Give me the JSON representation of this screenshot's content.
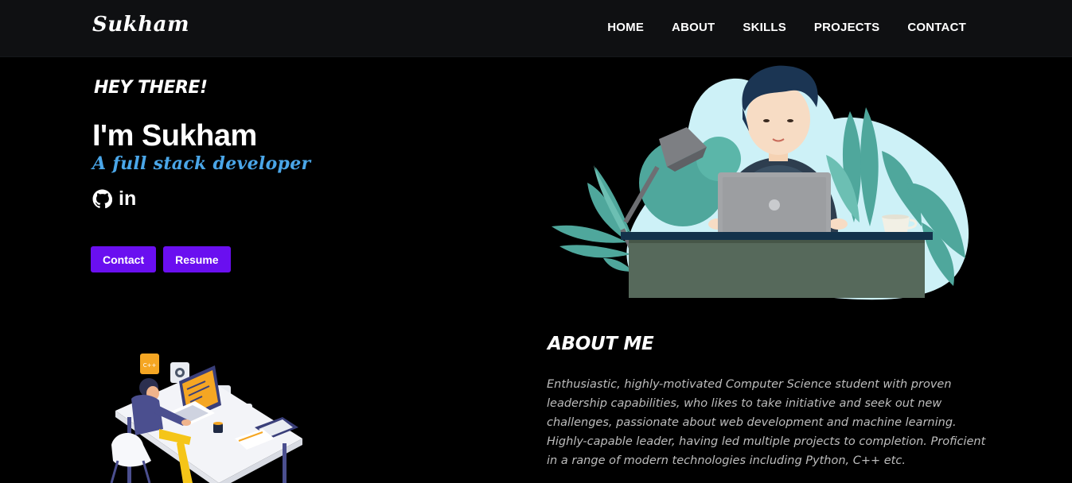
{
  "nav": {
    "logo": "Sukham",
    "links": [
      "HOME",
      "ABOUT",
      "SKILLS",
      "PROJECTS",
      "CONTACT"
    ]
  },
  "hero": {
    "greeting": "HEY THERE!",
    "name": "I'm Sukham",
    "role": "A full stack developer",
    "social": {
      "github_icon": "github-icon",
      "linkedin_text": "in"
    },
    "buttons": {
      "contact": "Contact",
      "resume": "Resume"
    }
  },
  "about": {
    "title": "ABOUT ME",
    "text": "Enthusiastic, highly-motivated Computer Science student with proven leadership capabilities, who likes to take initiative and seek out new challenges, passionate about web development and machine learning. Highly-capable leader, having led multiple projects to completion. Proficient in a range of modern technologies including Python, C++ etc."
  },
  "colors": {
    "background": "#000000",
    "navbar": "#0f1012",
    "accent_button": "#6a0ff0",
    "role_text": "#4aa6e8",
    "about_text": "#bdbdbd"
  }
}
